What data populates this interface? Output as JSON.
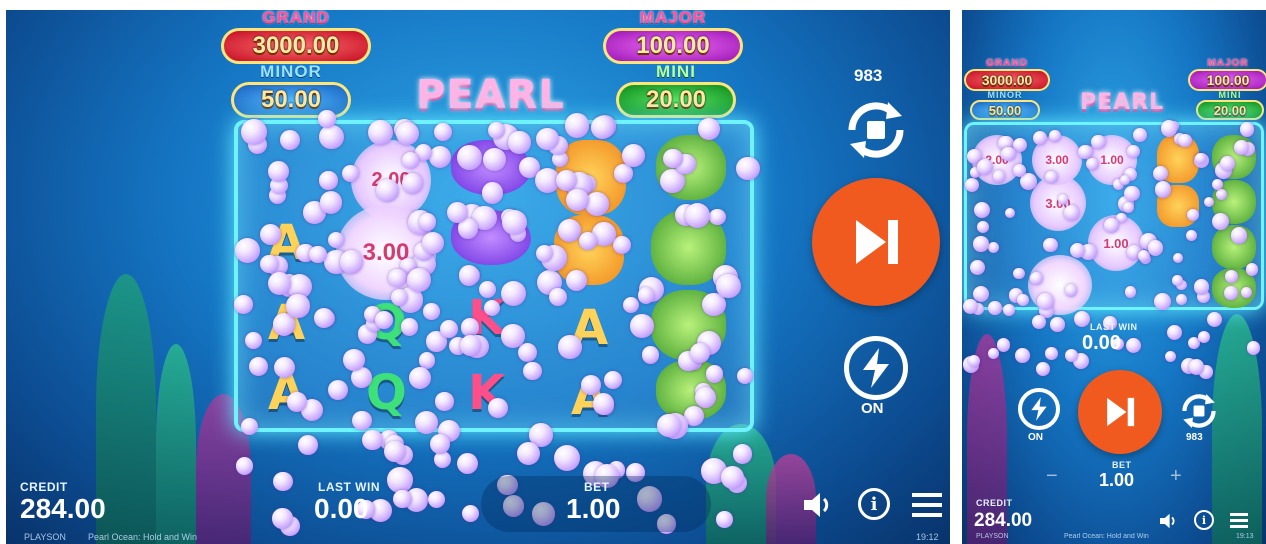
{
  "left": {
    "jackpots": {
      "grand": {
        "label": "GRAND",
        "value": "3000.00"
      },
      "minor": {
        "label": "MINOR",
        "value": "50.00"
      },
      "major": {
        "label": "MAJOR",
        "value": "100.00"
      },
      "mini": {
        "label": "MINI",
        "value": "20.00"
      }
    },
    "logo": "PEARL",
    "autoplay_count": "983",
    "turbo_state": "ON",
    "bubble_values": [
      "2.00",
      "3.00"
    ],
    "reel_letters": [
      "A",
      "A",
      "Q",
      "K",
      "A",
      "A",
      "Q",
      "K",
      "A"
    ],
    "credit_label": "CREDIT",
    "credit_value": "284.00",
    "lastwin_label": "LAST WIN",
    "lastwin_value": "0.00",
    "bet_label": "BET",
    "bet_value": "1.00",
    "footer_brand": "PLAYSON",
    "footer_game": "Pearl Ocean: Hold and Win",
    "clock": "19:12"
  },
  "right": {
    "jackpots": {
      "grand": {
        "label": "GRAND",
        "value": "3000.00"
      },
      "minor": {
        "label": "MINOR",
        "value": "50.00"
      },
      "major": {
        "label": "MAJOR",
        "value": "100.00"
      },
      "mini": {
        "label": "MINI",
        "value": "20.00"
      }
    },
    "logo": "PEARL",
    "bubble_values": [
      "2.00",
      "3.00",
      "1.00",
      "3.00",
      "1.00"
    ],
    "lastwin_label": "LAST WIN",
    "lastwin_value": "0.00",
    "turbo_state": "ON",
    "autoplay_count": "983",
    "bet_label": "BET",
    "bet_value": "1.00",
    "minus": "−",
    "plus": "+",
    "credit_label": "CREDIT",
    "credit_value": "284.00",
    "footer_brand": "PLAYSON",
    "footer_game": "Pearl Ocean: Hold and Win",
    "clock": "19:13"
  },
  "colors": {
    "spin_button": "#f05a1e",
    "frame_glow": "#6ff4ff",
    "grand_pill": "#e3162e",
    "major_pill": "#c62bd6",
    "minor_pill": "#1f86d9",
    "mini_pill": "#14b22b"
  },
  "icons": [
    "autoplay-stop-icon",
    "skip-forward-icon",
    "lightning-icon",
    "speaker-icon",
    "info-icon",
    "menu-icon"
  ]
}
